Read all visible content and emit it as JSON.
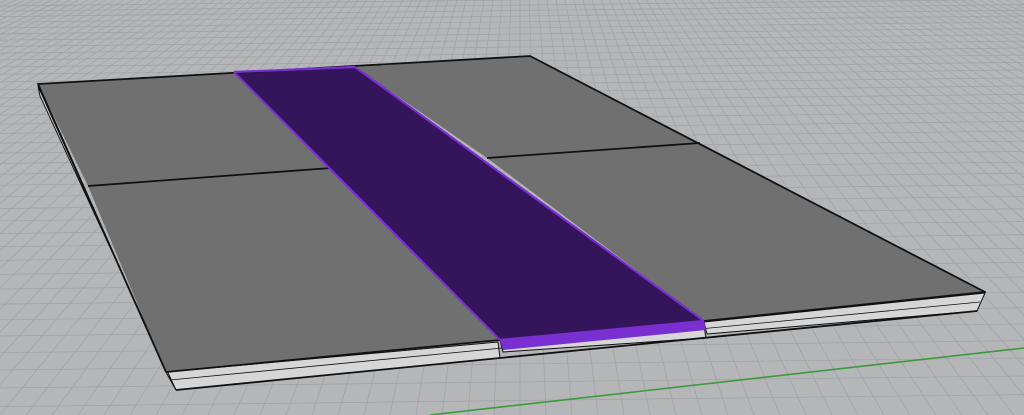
{
  "viewport": {
    "view": "perspective",
    "background_color": "#b4b6b8",
    "grid": {
      "visible": true,
      "minor_line_color": "#9fa2a5",
      "x_axis_color": "#3c9a3c"
    }
  },
  "model": {
    "panel_color": "#707070",
    "edge_color": "#111111",
    "slab_side_color": "#d6d6d6",
    "panels": [
      {
        "name": "top-left-panel",
        "selected": false
      },
      {
        "name": "bottom-left-panel",
        "selected": false
      },
      {
        "name": "top-right-panel",
        "selected": false
      },
      {
        "name": "bottom-right-panel",
        "selected": false
      },
      {
        "name": "center-strip",
        "selected": true
      }
    ],
    "selection": {
      "fill_color": "#34145a",
      "edge_color": "#7a2fd1"
    }
  }
}
